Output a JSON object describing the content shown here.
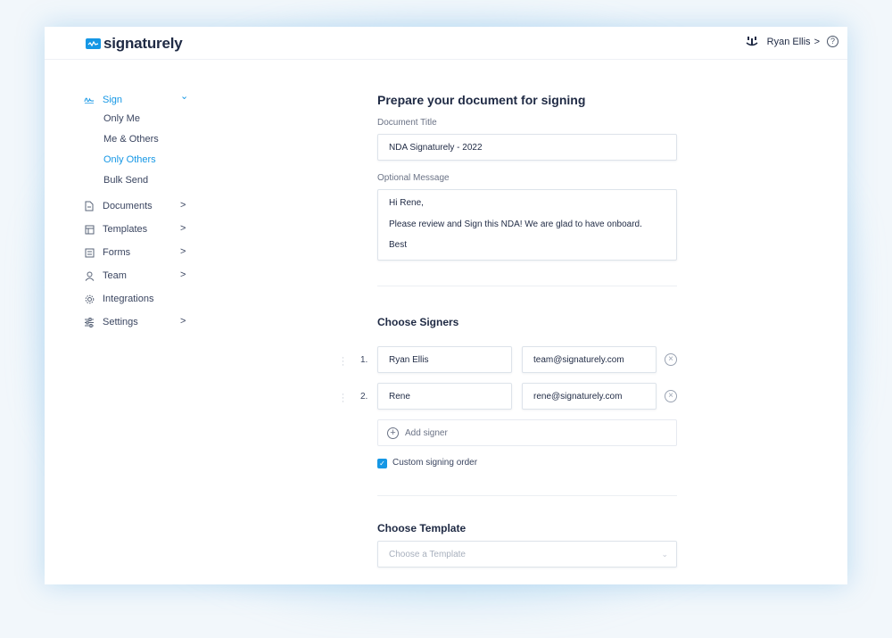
{
  "header": {
    "brand": "signaturely",
    "user_name": "Ryan Ellis",
    "user_chevron": ">",
    "help_glyph": "?"
  },
  "sidebar": {
    "sign": {
      "label": "Sign",
      "icon": "signature-icon"
    },
    "sign_sub": [
      {
        "label": "Only Me"
      },
      {
        "label": "Me & Others"
      },
      {
        "label": "Only Others",
        "active": true
      },
      {
        "label": "Bulk Send"
      }
    ],
    "items": [
      {
        "label": "Documents",
        "icon": "document-icon",
        "chevron": true
      },
      {
        "label": "Templates",
        "icon": "template-icon",
        "chevron": true
      },
      {
        "label": "Forms",
        "icon": "form-icon",
        "chevron": true
      },
      {
        "label": "Team",
        "icon": "user-icon",
        "chevron": true
      },
      {
        "label": "Integrations",
        "icon": "gear-icon",
        "chevron": false
      },
      {
        "label": "Settings",
        "icon": "sliders-icon",
        "chevron": true
      }
    ],
    "chevron_glyph": ">",
    "chevron_down_glyph": "⌄"
  },
  "main": {
    "title": "Prepare your document for signing",
    "document_title_label": "Document Title",
    "document_title_value": "NDA Signaturely - 2022",
    "message_label": "Optional Message",
    "message_lines": [
      "Hi Rene,",
      "Please review and Sign this NDA! We are glad to have onboard.",
      "Best"
    ],
    "signers_heading": "Choose Signers",
    "signers": [
      {
        "number": "1.",
        "name": "Ryan Ellis",
        "email": "team@signaturely.com"
      },
      {
        "number": "2.",
        "name": "Rene",
        "email": "rene@signaturely.com"
      }
    ],
    "add_signer_label": "Add signer",
    "custom_order_label": "Custom signing order",
    "custom_order_checked": true,
    "template_heading": "Choose Template",
    "template_placeholder": "Choose a Template"
  },
  "colors": {
    "accent": "#1597e5",
    "text": "#1f2a44",
    "muted": "#6b7386",
    "border": "#dde3ea"
  }
}
